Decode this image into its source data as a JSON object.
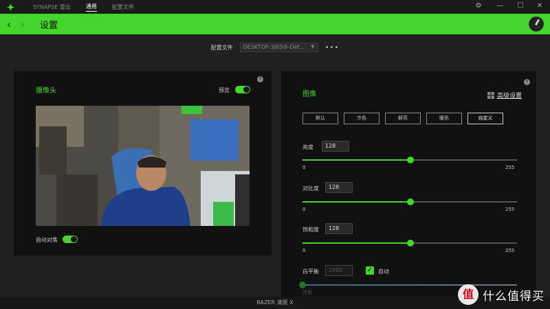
{
  "titlebar": {
    "brand": "SYNAPSE 雷云",
    "nav": [
      "通用",
      "配置文件"
    ],
    "controls": [
      "⚙",
      "—",
      "☐",
      "✕"
    ]
  },
  "header": {
    "title": "设置",
    "back_icon": "chevron-left-icon",
    "forward_icon": "chevron-right-icon"
  },
  "profile": {
    "label": "配置文件",
    "selected": "DESKTOP-3J85I8-Def...",
    "more": "•••"
  },
  "camera_panel": {
    "title": "摄像头",
    "preview_label": "预览",
    "preview_on": true,
    "autofocus_label": "自动对焦",
    "autofocus_on": true,
    "help": "?"
  },
  "image_panel": {
    "title": "图像",
    "advanced_label": "高级设置",
    "help": "?",
    "presets": [
      "默认",
      "冷色",
      "鲜亮",
      "暖色",
      "自定义"
    ],
    "selected_preset": "自定义",
    "sliders": [
      {
        "label": "亮度",
        "value": "128",
        "min": "0",
        "max": "255",
        "level": 128
      },
      {
        "label": "对比度",
        "value": "128",
        "min": "0",
        "max": "255",
        "level": 128
      },
      {
        "label": "饱和度",
        "value": "128",
        "min": "0",
        "max": "255",
        "level": 128
      }
    ],
    "white_balance": {
      "label": "白平衡",
      "value": "2800",
      "auto_label": "自动",
      "auto_checked": true,
      "min_label": "冷色"
    }
  },
  "statusbar": {
    "device": "RAZER 清姬 X"
  },
  "watermark": {
    "logo": "值",
    "text": "什么值得买"
  },
  "colors": {
    "accent": "#44d62c",
    "panel": "#111111",
    "background": "#202020"
  }
}
